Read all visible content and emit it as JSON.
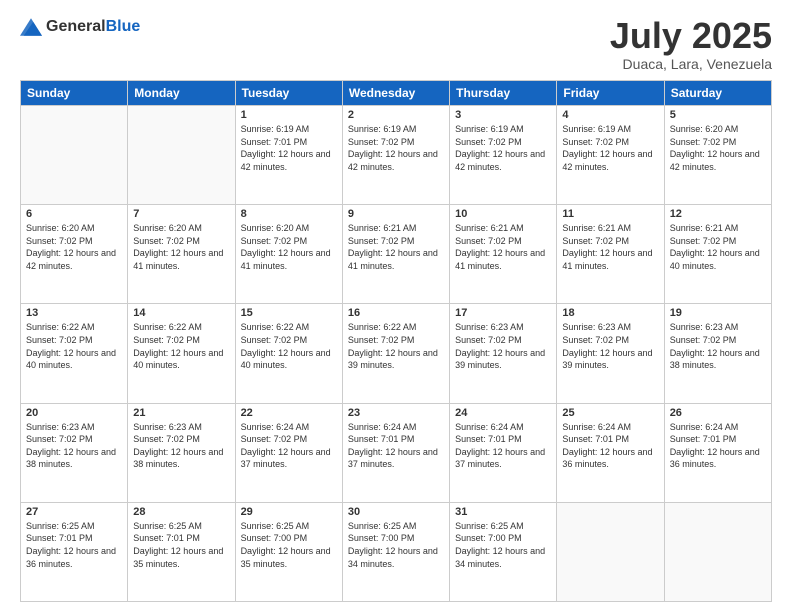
{
  "logo": {
    "general": "General",
    "blue": "Blue"
  },
  "header": {
    "month_year": "July 2025",
    "location": "Duaca, Lara, Venezuela"
  },
  "days_of_week": [
    "Sunday",
    "Monday",
    "Tuesday",
    "Wednesday",
    "Thursday",
    "Friday",
    "Saturday"
  ],
  "weeks": [
    [
      {
        "day": "",
        "info": ""
      },
      {
        "day": "",
        "info": ""
      },
      {
        "day": "1",
        "info": "Sunrise: 6:19 AM\nSunset: 7:01 PM\nDaylight: 12 hours and 42 minutes."
      },
      {
        "day": "2",
        "info": "Sunrise: 6:19 AM\nSunset: 7:02 PM\nDaylight: 12 hours and 42 minutes."
      },
      {
        "day": "3",
        "info": "Sunrise: 6:19 AM\nSunset: 7:02 PM\nDaylight: 12 hours and 42 minutes."
      },
      {
        "day": "4",
        "info": "Sunrise: 6:19 AM\nSunset: 7:02 PM\nDaylight: 12 hours and 42 minutes."
      },
      {
        "day": "5",
        "info": "Sunrise: 6:20 AM\nSunset: 7:02 PM\nDaylight: 12 hours and 42 minutes."
      }
    ],
    [
      {
        "day": "6",
        "info": "Sunrise: 6:20 AM\nSunset: 7:02 PM\nDaylight: 12 hours and 42 minutes."
      },
      {
        "day": "7",
        "info": "Sunrise: 6:20 AM\nSunset: 7:02 PM\nDaylight: 12 hours and 41 minutes."
      },
      {
        "day": "8",
        "info": "Sunrise: 6:20 AM\nSunset: 7:02 PM\nDaylight: 12 hours and 41 minutes."
      },
      {
        "day": "9",
        "info": "Sunrise: 6:21 AM\nSunset: 7:02 PM\nDaylight: 12 hours and 41 minutes."
      },
      {
        "day": "10",
        "info": "Sunrise: 6:21 AM\nSunset: 7:02 PM\nDaylight: 12 hours and 41 minutes."
      },
      {
        "day": "11",
        "info": "Sunrise: 6:21 AM\nSunset: 7:02 PM\nDaylight: 12 hours and 41 minutes."
      },
      {
        "day": "12",
        "info": "Sunrise: 6:21 AM\nSunset: 7:02 PM\nDaylight: 12 hours and 40 minutes."
      }
    ],
    [
      {
        "day": "13",
        "info": "Sunrise: 6:22 AM\nSunset: 7:02 PM\nDaylight: 12 hours and 40 minutes."
      },
      {
        "day": "14",
        "info": "Sunrise: 6:22 AM\nSunset: 7:02 PM\nDaylight: 12 hours and 40 minutes."
      },
      {
        "day": "15",
        "info": "Sunrise: 6:22 AM\nSunset: 7:02 PM\nDaylight: 12 hours and 40 minutes."
      },
      {
        "day": "16",
        "info": "Sunrise: 6:22 AM\nSunset: 7:02 PM\nDaylight: 12 hours and 39 minutes."
      },
      {
        "day": "17",
        "info": "Sunrise: 6:23 AM\nSunset: 7:02 PM\nDaylight: 12 hours and 39 minutes."
      },
      {
        "day": "18",
        "info": "Sunrise: 6:23 AM\nSunset: 7:02 PM\nDaylight: 12 hours and 39 minutes."
      },
      {
        "day": "19",
        "info": "Sunrise: 6:23 AM\nSunset: 7:02 PM\nDaylight: 12 hours and 38 minutes."
      }
    ],
    [
      {
        "day": "20",
        "info": "Sunrise: 6:23 AM\nSunset: 7:02 PM\nDaylight: 12 hours and 38 minutes."
      },
      {
        "day": "21",
        "info": "Sunrise: 6:23 AM\nSunset: 7:02 PM\nDaylight: 12 hours and 38 minutes."
      },
      {
        "day": "22",
        "info": "Sunrise: 6:24 AM\nSunset: 7:02 PM\nDaylight: 12 hours and 37 minutes."
      },
      {
        "day": "23",
        "info": "Sunrise: 6:24 AM\nSunset: 7:01 PM\nDaylight: 12 hours and 37 minutes."
      },
      {
        "day": "24",
        "info": "Sunrise: 6:24 AM\nSunset: 7:01 PM\nDaylight: 12 hours and 37 minutes."
      },
      {
        "day": "25",
        "info": "Sunrise: 6:24 AM\nSunset: 7:01 PM\nDaylight: 12 hours and 36 minutes."
      },
      {
        "day": "26",
        "info": "Sunrise: 6:24 AM\nSunset: 7:01 PM\nDaylight: 12 hours and 36 minutes."
      }
    ],
    [
      {
        "day": "27",
        "info": "Sunrise: 6:25 AM\nSunset: 7:01 PM\nDaylight: 12 hours and 36 minutes."
      },
      {
        "day": "28",
        "info": "Sunrise: 6:25 AM\nSunset: 7:01 PM\nDaylight: 12 hours and 35 minutes."
      },
      {
        "day": "29",
        "info": "Sunrise: 6:25 AM\nSunset: 7:00 PM\nDaylight: 12 hours and 35 minutes."
      },
      {
        "day": "30",
        "info": "Sunrise: 6:25 AM\nSunset: 7:00 PM\nDaylight: 12 hours and 34 minutes."
      },
      {
        "day": "31",
        "info": "Sunrise: 6:25 AM\nSunset: 7:00 PM\nDaylight: 12 hours and 34 minutes."
      },
      {
        "day": "",
        "info": ""
      },
      {
        "day": "",
        "info": ""
      }
    ]
  ]
}
